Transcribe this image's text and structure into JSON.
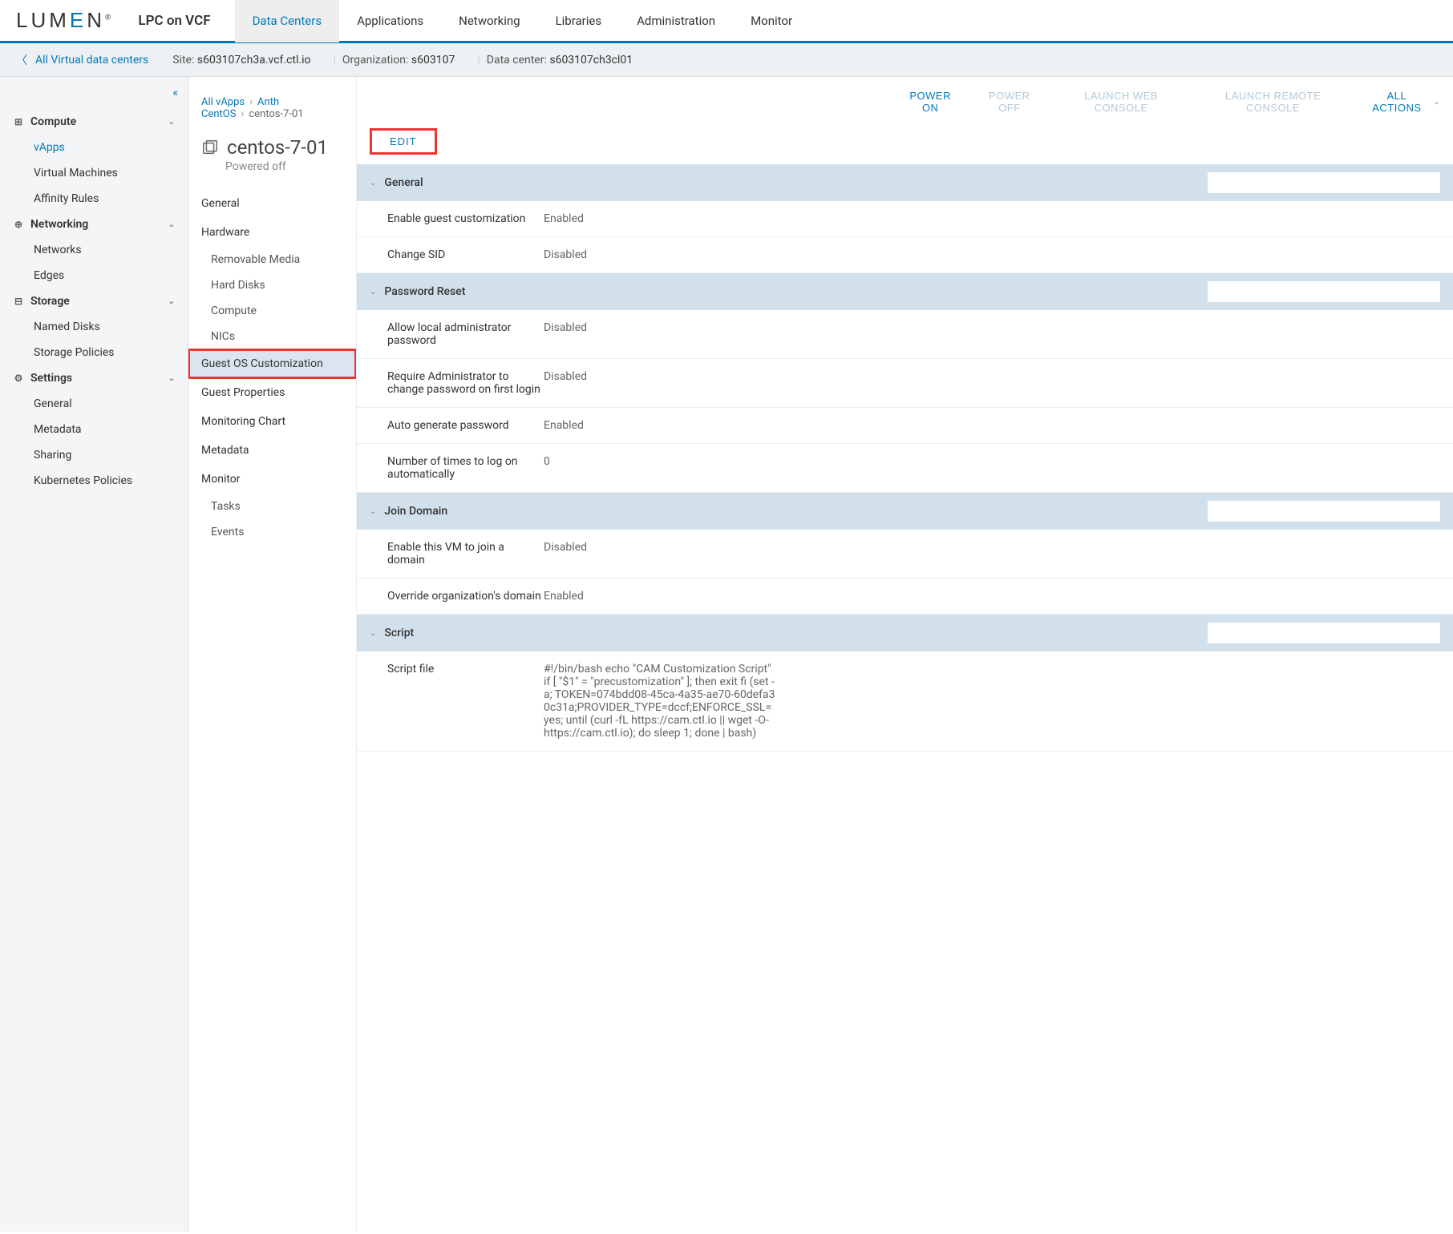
{
  "brand": {
    "name": "LUMEN",
    "product": "LPC on VCF"
  },
  "topNav": [
    {
      "label": "Data Centers",
      "active": true
    },
    {
      "label": "Applications",
      "active": false
    },
    {
      "label": "Networking",
      "active": false
    },
    {
      "label": "Libraries",
      "active": false
    },
    {
      "label": "Administration",
      "active": false
    },
    {
      "label": "Monitor",
      "active": false
    }
  ],
  "context": {
    "back": "All Virtual data centers",
    "siteLabel": "Site:",
    "siteValue": "s603107ch3a.vcf.ctl.io",
    "orgLabel": "Organization:",
    "orgValue": "s603107",
    "dcLabel": "Data center:",
    "dcValue": "s603107ch3cl01"
  },
  "leftNav": [
    {
      "title": "Compute",
      "icon": "grid",
      "items": [
        {
          "label": "vApps",
          "active": true
        },
        {
          "label": "Virtual Machines"
        },
        {
          "label": "Affinity Rules"
        }
      ]
    },
    {
      "title": "Networking",
      "icon": "globe",
      "items": [
        {
          "label": "Networks"
        },
        {
          "label": "Edges"
        }
      ]
    },
    {
      "title": "Storage",
      "icon": "db",
      "items": [
        {
          "label": "Named Disks"
        },
        {
          "label": "Storage Policies"
        }
      ]
    },
    {
      "title": "Settings",
      "icon": "gear",
      "items": [
        {
          "label": "General"
        },
        {
          "label": "Metadata"
        },
        {
          "label": "Sharing"
        },
        {
          "label": "Kubernetes Policies"
        }
      ]
    }
  ],
  "breadcrumb": [
    {
      "label": "All vApps",
      "link": true
    },
    {
      "label": "Anth CentOS",
      "link": true
    },
    {
      "label": "centos-7-01",
      "link": false
    }
  ],
  "vm": {
    "name": "centos-7-01",
    "status": "Powered off"
  },
  "vmActions": [
    {
      "label": "POWER ON",
      "enabled": true
    },
    {
      "label": "POWER OFF",
      "enabled": false
    },
    {
      "label": "LAUNCH WEB CONSOLE",
      "enabled": false
    },
    {
      "label": "LAUNCH REMOTE CONSOLE",
      "enabled": false
    }
  ],
  "allActions": "ALL ACTIONS",
  "midNav": [
    {
      "label": "General",
      "type": "main"
    },
    {
      "label": "Hardware",
      "type": "main"
    },
    {
      "label": "Removable Media",
      "type": "sub"
    },
    {
      "label": "Hard Disks",
      "type": "sub"
    },
    {
      "label": "Compute",
      "type": "sub"
    },
    {
      "label": "NICs",
      "type": "sub"
    },
    {
      "label": "Guest OS Customization",
      "type": "main",
      "selected": true
    },
    {
      "label": "Guest Properties",
      "type": "main"
    },
    {
      "label": "Monitoring Chart",
      "type": "main"
    },
    {
      "label": "Metadata",
      "type": "main"
    },
    {
      "label": "Monitor",
      "type": "main"
    },
    {
      "label": "Tasks",
      "type": "sub"
    },
    {
      "label": "Events",
      "type": "sub"
    }
  ],
  "editLabel": "EDIT",
  "sections": [
    {
      "title": "General",
      "rows": [
        {
          "label": "Enable guest customization",
          "value": "Enabled"
        },
        {
          "label": "Change SID",
          "value": "Disabled"
        }
      ]
    },
    {
      "title": "Password Reset",
      "rows": [
        {
          "label": "Allow local administrator password",
          "value": "Disabled"
        },
        {
          "label": "Require Administrator to change password on first login",
          "value": "Disabled"
        },
        {
          "label": "Auto generate password",
          "value": "Enabled"
        },
        {
          "label": "Number of times to log on automatically",
          "value": "0"
        }
      ]
    },
    {
      "title": "Join Domain",
      "rows": [
        {
          "label": "Enable this VM to join a domain",
          "value": "Disabled"
        },
        {
          "label": "Override organization's domain",
          "value": "Enabled"
        }
      ]
    },
    {
      "title": "Script",
      "rows": [
        {
          "label": "Script file",
          "value": "#!/bin/bash echo \"CAM Customization Script\" if [ \"$1\" = \"precustomization\" ]; then exit fi (set -a; TOKEN=074bdd08-45ca-4a35-ae70-60defa30c31a;PROVIDER_TYPE=dccf;ENFORCE_SSL=yes; until (curl -fL https://cam.ctl.io || wget -O- https://cam.ctl.io); do sleep 1; done | bash)"
        }
      ]
    }
  ]
}
